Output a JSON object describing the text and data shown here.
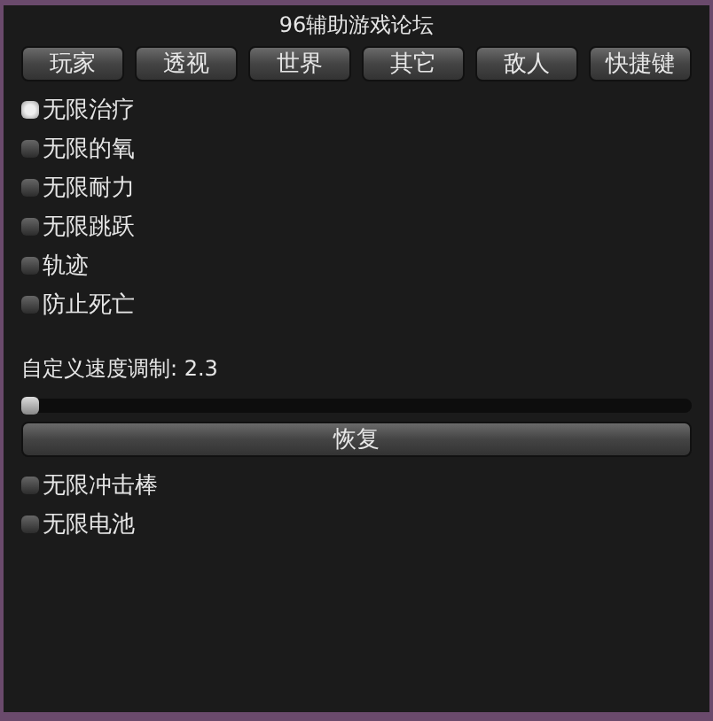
{
  "window": {
    "title": "96辅助游戏论坛"
  },
  "tabs": [
    {
      "label": "玩家"
    },
    {
      "label": "透视"
    },
    {
      "label": "世界"
    },
    {
      "label": "其它"
    },
    {
      "label": "敌人"
    },
    {
      "label": "快捷键"
    }
  ],
  "options": [
    {
      "label": "无限治疗",
      "checked": true
    },
    {
      "label": "无限的氧",
      "checked": false
    },
    {
      "label": "无限耐力",
      "checked": false
    },
    {
      "label": "无限跳跃",
      "checked": false
    },
    {
      "label": "轨迹",
      "checked": false
    },
    {
      "label": "防止死亡",
      "checked": false
    }
  ],
  "speed": {
    "label": "自定义速度调制: 2.3",
    "level": 0.0
  },
  "reset_button": "恢复",
  "more_options": [
    {
      "label": "无限冲击棒",
      "checked": false
    },
    {
      "label": "无限电池",
      "checked": false
    }
  ]
}
